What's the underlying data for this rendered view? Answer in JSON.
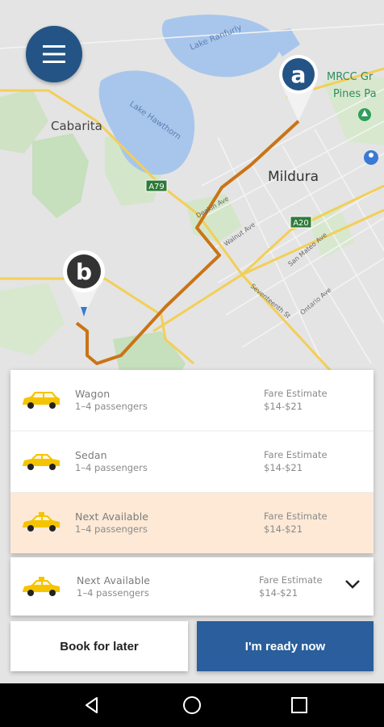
{
  "map": {
    "labels": {
      "lake_ranfurly": "Lake Ranfurly",
      "lake_hawthorn": "Lake Hawthorn",
      "cabarita": "Cabarita",
      "mildura": "Mildura",
      "mrcc": "MRCC Gr",
      "pines": "Pines Pa",
      "a79": "A79",
      "a20": "A20",
      "walnut": "Walnut Ave",
      "deakin": "Deakin Ave",
      "seventeenth": "Seventeenth St",
      "san_mateo": "San Mateo Ave",
      "ontario": "Ontario Ave"
    },
    "pin_a": "a",
    "pin_b": "b",
    "route_color": "#c97416",
    "road_color": "#f2cf57"
  },
  "options": [
    {
      "name": "Wagon",
      "passengers": "1–4 passengers",
      "fare_label": "Fare Estimate",
      "fare": "$14-$21",
      "selected": false
    },
    {
      "name": "Sedan",
      "passengers": "1–4 passengers",
      "fare_label": "Fare Estimate",
      "fare": "$14-$21",
      "selected": false
    },
    {
      "name": "Next Available",
      "passengers": "1–4 passengers",
      "fare_label": "Fare Estimate",
      "fare": "$14-$21",
      "selected": true
    }
  ],
  "current": {
    "name": "Next Available",
    "passengers": "1–4 passengers",
    "fare_label": "Fare Estimate",
    "fare": "$14-$21"
  },
  "buttons": {
    "later": "Book for later",
    "now": "I'm ready now"
  },
  "colors": {
    "accent": "#2a5e9c",
    "menu": "#235485",
    "selected_bg": "#fde9d6",
    "car": "#f5c400"
  }
}
